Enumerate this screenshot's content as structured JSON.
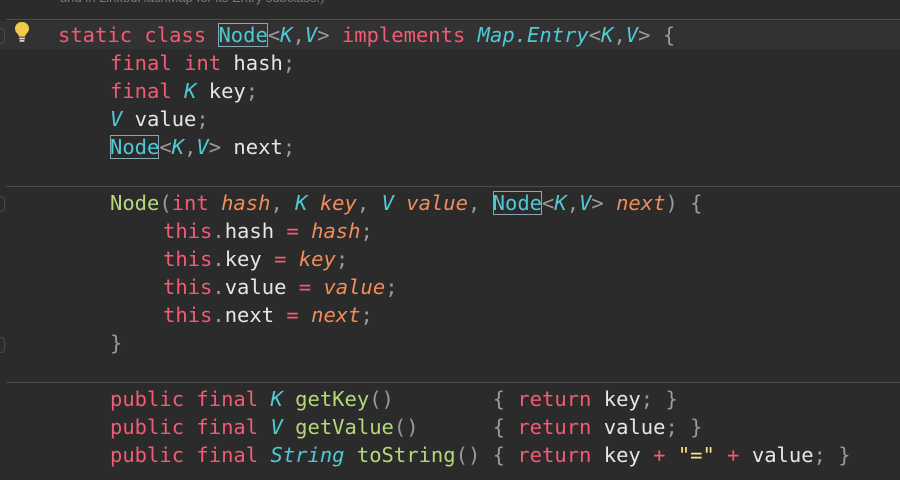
{
  "editor": {
    "doc_comment": "and in LinkedHashMap for its Entry subclass.)",
    "lines": [
      {
        "indent": 8,
        "tokens": [
          [
            "kw",
            "static"
          ],
          [
            "pu",
            " "
          ],
          [
            "kw",
            "class"
          ],
          [
            "pu",
            " "
          ],
          [
            "cls hl",
            "Node"
          ],
          [
            "pu",
            "<"
          ],
          [
            "ty",
            "K"
          ],
          [
            "pu",
            ","
          ],
          [
            "ty",
            "V"
          ],
          [
            "pu",
            "> "
          ],
          [
            "kw",
            "implements"
          ],
          [
            "pu",
            " "
          ],
          [
            "ty",
            "Map.Entry"
          ],
          [
            "pu",
            "<"
          ],
          [
            "ty",
            "K"
          ],
          [
            "pu",
            ","
          ],
          [
            "ty",
            "V"
          ],
          [
            "pu",
            "> {"
          ]
        ]
      },
      {
        "indent": 108,
        "tokens": [
          [
            "kw",
            "final"
          ],
          [
            "pu",
            " "
          ],
          [
            "kw",
            "int"
          ],
          [
            "id",
            " hash"
          ],
          [
            "pu",
            ";"
          ]
        ]
      },
      {
        "indent": 108,
        "tokens": [
          [
            "kw",
            "final"
          ],
          [
            "pu",
            " "
          ],
          [
            "ty",
            "K"
          ],
          [
            "id",
            " key"
          ],
          [
            "pu",
            ";"
          ]
        ]
      },
      {
        "indent": 108,
        "tokens": [
          [
            "ty",
            "V"
          ],
          [
            "id",
            " value"
          ],
          [
            "pu",
            ";"
          ]
        ]
      },
      {
        "indent": 108,
        "tokens": [
          [
            "cls hl",
            "Node"
          ],
          [
            "pu",
            "<"
          ],
          [
            "ty",
            "K"
          ],
          [
            "pu",
            ","
          ],
          [
            "ty",
            "V"
          ],
          [
            "pu",
            ">"
          ],
          [
            "id",
            " next"
          ],
          [
            "pu",
            ";"
          ]
        ]
      },
      {
        "indent": 108,
        "tokens": []
      },
      {
        "indent": 108,
        "tokens": [
          [
            "gn",
            "Node"
          ],
          [
            "pu",
            "("
          ],
          [
            "kw",
            "int"
          ],
          [
            "pu",
            " "
          ],
          [
            "pr",
            "hash"
          ],
          [
            "pu",
            ", "
          ],
          [
            "ty",
            "K"
          ],
          [
            "pu",
            " "
          ],
          [
            "pr",
            "key"
          ],
          [
            "pu",
            ", "
          ],
          [
            "ty",
            "V"
          ],
          [
            "pu",
            " "
          ],
          [
            "pr",
            "value"
          ],
          [
            "pu",
            ", "
          ],
          [
            "cls hl",
            "Node"
          ],
          [
            "pu",
            "<"
          ],
          [
            "ty",
            "K"
          ],
          [
            "pu",
            ","
          ],
          [
            "ty",
            "V"
          ],
          [
            "pu",
            "> "
          ],
          [
            "pr",
            "next"
          ],
          [
            "pu",
            ") {"
          ]
        ]
      },
      {
        "indent": 161,
        "tokens": [
          [
            "kw",
            "this"
          ],
          [
            "pu",
            "."
          ],
          [
            "id",
            "hash"
          ],
          [
            "op",
            " = "
          ],
          [
            "pr",
            "hash"
          ],
          [
            "pu",
            ";"
          ]
        ]
      },
      {
        "indent": 161,
        "tokens": [
          [
            "kw",
            "this"
          ],
          [
            "pu",
            "."
          ],
          [
            "id",
            "key"
          ],
          [
            "op",
            " = "
          ],
          [
            "pr",
            "key"
          ],
          [
            "pu",
            ";"
          ]
        ]
      },
      {
        "indent": 161,
        "tokens": [
          [
            "kw",
            "this"
          ],
          [
            "pu",
            "."
          ],
          [
            "id",
            "value"
          ],
          [
            "op",
            " = "
          ],
          [
            "pr",
            "value"
          ],
          [
            "pu",
            ";"
          ]
        ]
      },
      {
        "indent": 161,
        "tokens": [
          [
            "kw",
            "this"
          ],
          [
            "pu",
            "."
          ],
          [
            "id",
            "next"
          ],
          [
            "op",
            " = "
          ],
          [
            "pr",
            "next"
          ],
          [
            "pu",
            ";"
          ]
        ]
      },
      {
        "indent": 108,
        "tokens": [
          [
            "pu",
            "}"
          ]
        ]
      },
      {
        "indent": 108,
        "tokens": []
      },
      {
        "indent": 108,
        "tokens": [
          [
            "kw",
            "public"
          ],
          [
            "pu",
            " "
          ],
          [
            "kw",
            "final"
          ],
          [
            "pu",
            " "
          ],
          [
            "ty",
            "K"
          ],
          [
            "pu",
            " "
          ],
          [
            "gn",
            "getKey"
          ],
          [
            "pu",
            "()        { "
          ],
          [
            "kw",
            "return"
          ],
          [
            "id",
            " key"
          ],
          [
            "pu",
            "; }"
          ]
        ]
      },
      {
        "indent": 108,
        "tokens": [
          [
            "kw",
            "public"
          ],
          [
            "pu",
            " "
          ],
          [
            "kw",
            "final"
          ],
          [
            "pu",
            " "
          ],
          [
            "ty",
            "V"
          ],
          [
            "pu",
            " "
          ],
          [
            "gn",
            "getValue"
          ],
          [
            "pu",
            "()      { "
          ],
          [
            "kw",
            "return"
          ],
          [
            "id",
            " value"
          ],
          [
            "pu",
            "; }"
          ]
        ]
      },
      {
        "indent": 108,
        "tokens": [
          [
            "kw",
            "public"
          ],
          [
            "pu",
            " "
          ],
          [
            "kw",
            "final"
          ],
          [
            "pu",
            " "
          ],
          [
            "ty",
            "String"
          ],
          [
            "pu",
            " "
          ],
          [
            "gn",
            "toString"
          ],
          [
            "pu",
            "() { "
          ],
          [
            "kw",
            "return"
          ],
          [
            "id",
            " key"
          ],
          [
            "op",
            " + "
          ],
          [
            "st",
            "\"=\""
          ],
          [
            "op",
            " + "
          ],
          [
            "id",
            "value"
          ],
          [
            "pu",
            "; }"
          ]
        ]
      }
    ]
  },
  "gutter": {
    "intention_icon": "lightbulb-icon"
  },
  "colors": {
    "background": "#2b2b2b",
    "keyword": "#f35a74",
    "type": "#4ec9d6",
    "method": "#b5d77a",
    "parameter": "#f08d5b",
    "string": "#f2e28c",
    "identifier": "#e6e6e6",
    "punctuation": "#9a9a9a",
    "highlight_border": "#8aa6b0"
  }
}
